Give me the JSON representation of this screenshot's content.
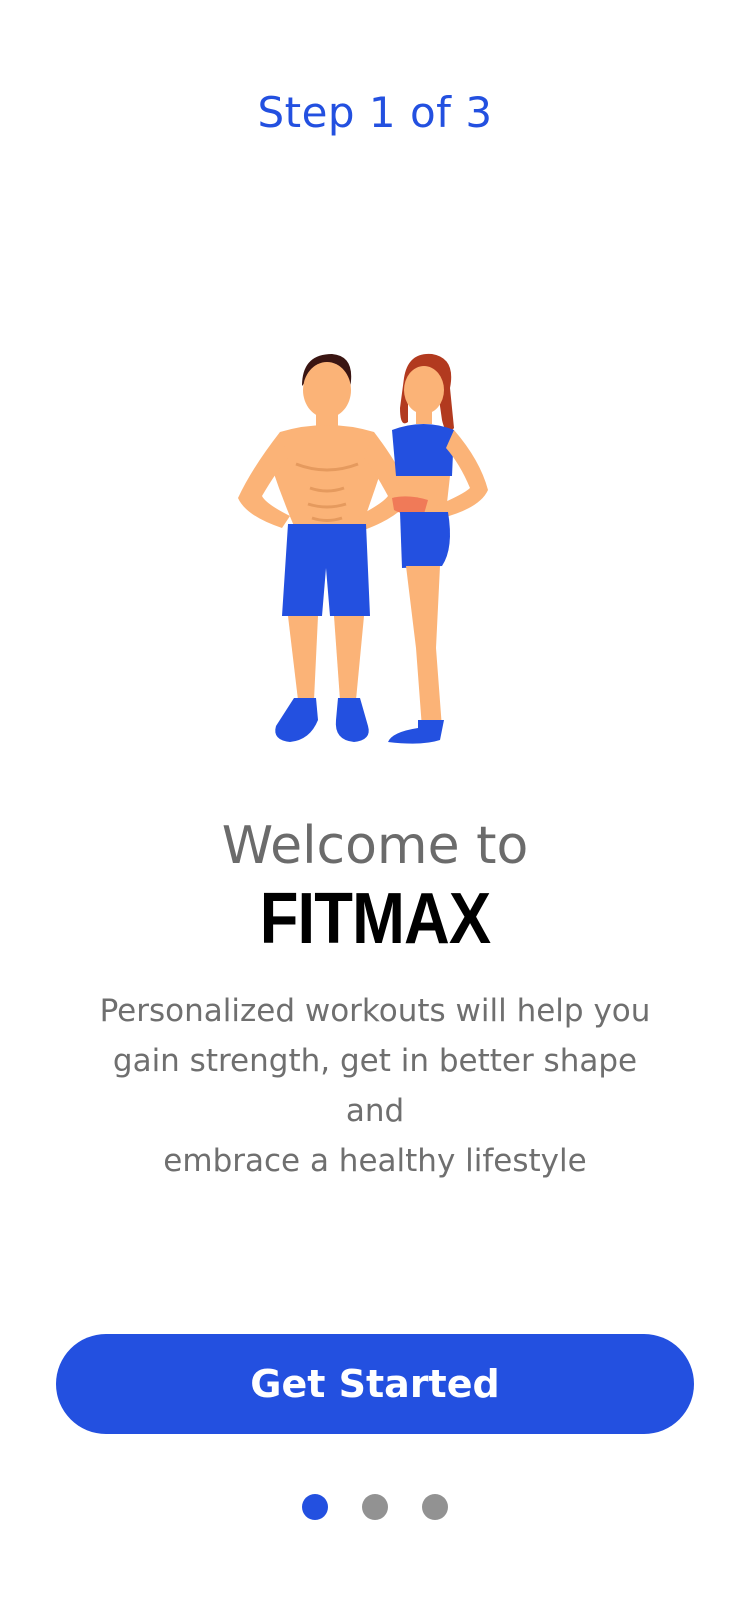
{
  "header": {
    "step_text": "Step 1 of 3"
  },
  "illustration": {
    "name": "fitness-couple-illustration"
  },
  "content": {
    "welcome_text": "Welcome to",
    "brand_text": "FITMAX",
    "description_line1": "Personalized workouts will help you",
    "description_line2": "gain strength, get in better shape and",
    "description_line3": "embrace a healthy lifestyle"
  },
  "actions": {
    "primary_label": "Get Started"
  },
  "pager": {
    "count": 3,
    "active_index": 0
  },
  "colors": {
    "accent": "#2350e0",
    "muted_dot": "#929292",
    "text_gray": "#6f6f6f"
  }
}
